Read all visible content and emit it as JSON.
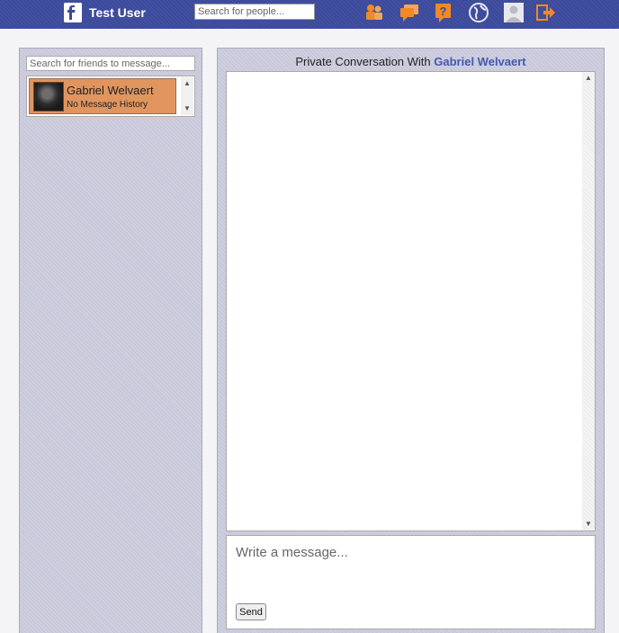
{
  "header": {
    "username": "Test User",
    "search_placeholder": "Search for people..."
  },
  "nav_icons": [
    "friends-icon",
    "messages-icon",
    "help-icon",
    "globe-icon",
    "profile-icon",
    "logout-icon"
  ],
  "left_panel": {
    "search_placeholder": "Search for friends to message...",
    "friends": [
      {
        "name": "Gabriel Welvaert",
        "status": "No Message History"
      }
    ]
  },
  "conversation": {
    "title_prefix": "Private Conversation With",
    "partner_name": "Gabriel Welvaert",
    "message_placeholder": "Write a message...",
    "send_label": "Send"
  },
  "colors": {
    "topbar": "#3c4a9c",
    "panel": "#c8c8da",
    "selected_friend": "#e0955e",
    "accent": "#4359b0",
    "icon_orange": "#f08a24"
  }
}
